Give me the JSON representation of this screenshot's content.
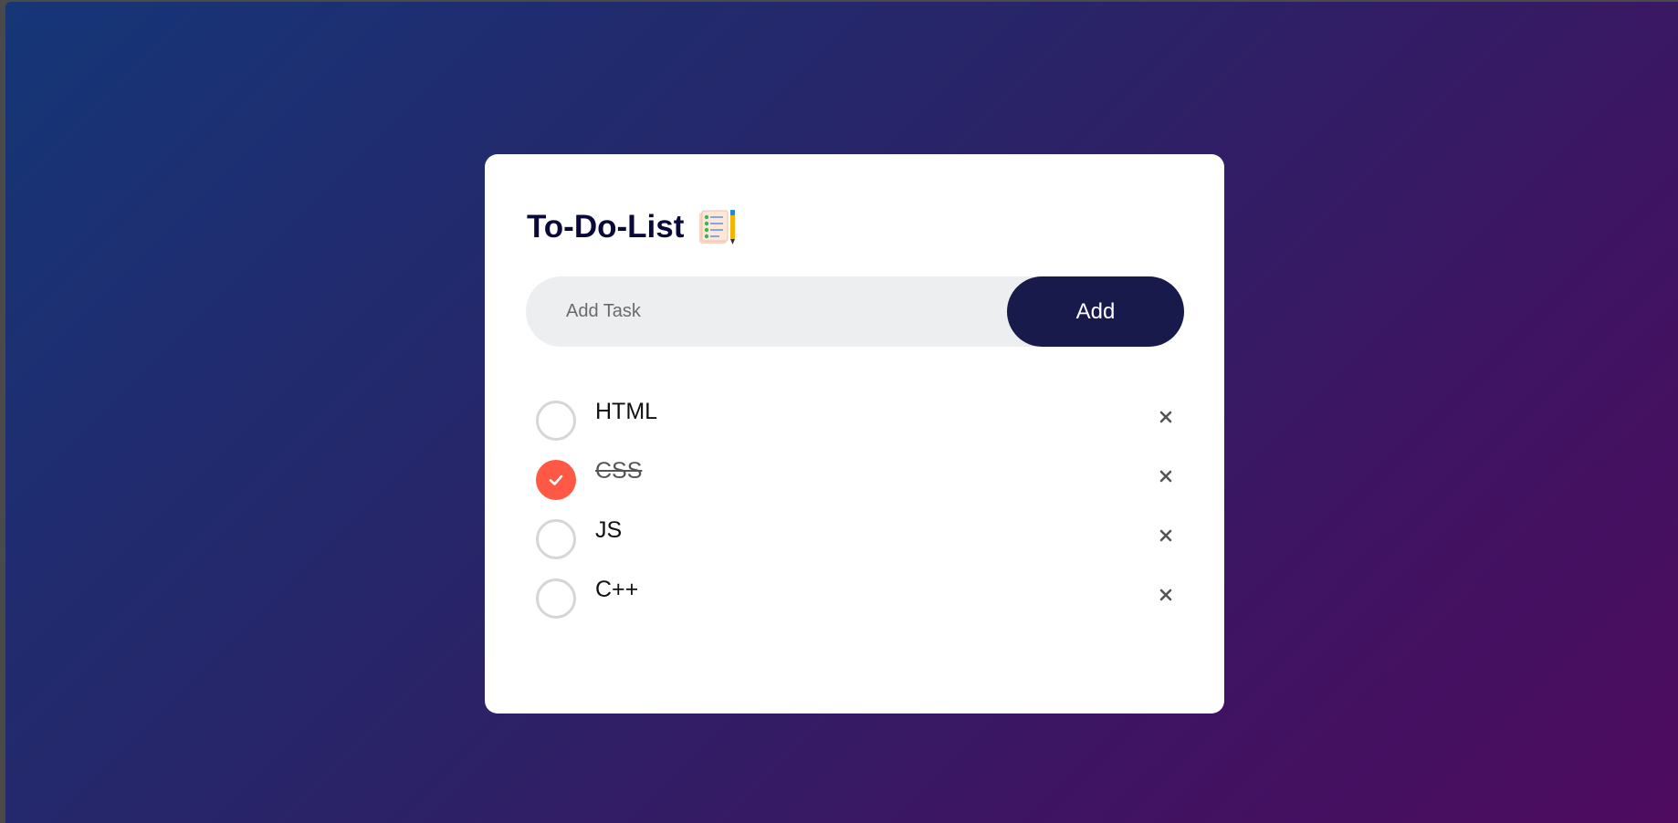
{
  "app": {
    "title": "To-Do-List",
    "title_icon": "notepad-checklist-icon"
  },
  "input": {
    "placeholder": "Add Task",
    "value": "",
    "add_label": "Add"
  },
  "tasks": [
    {
      "label": "HTML",
      "checked": false,
      "delete_icon": "close-icon"
    },
    {
      "label": "CSS",
      "checked": true,
      "delete_icon": "close-icon"
    },
    {
      "label": "JS",
      "checked": false,
      "delete_icon": "close-icon"
    },
    {
      "label": "C++",
      "checked": false,
      "delete_icon": "close-icon"
    }
  ],
  "colors": {
    "background_start": "#153677",
    "background_end": "#4e0b5f",
    "card": "#ffffff",
    "title": "#0a0a3a",
    "add_button": "#171a4a",
    "input_bg": "#edeef0",
    "checked": "#ff5945",
    "unchecked_border": "#d6d6d6"
  }
}
